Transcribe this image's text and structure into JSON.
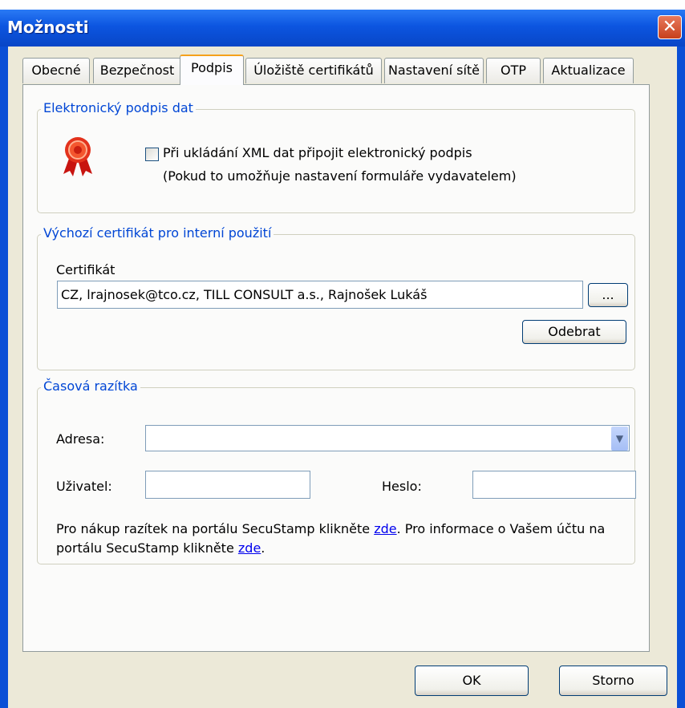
{
  "window": {
    "title": "Možnosti"
  },
  "tabs": [
    {
      "label": "Obecné"
    },
    {
      "label": "Bezpečnost"
    },
    {
      "label": "Podpis"
    },
    {
      "label": "Úložiště certifikátů"
    },
    {
      "label": "Nastavení sítě"
    },
    {
      "label": "OTP"
    },
    {
      "label": "Aktualizace"
    }
  ],
  "active_tab": "Podpis",
  "signature_group": {
    "legend": "Elektronický podpis dat",
    "icon": "award-ribbon-icon",
    "checkbox_label": "Při ukládání XML dat připojit elektronický podpis",
    "checkbox_checked": false,
    "note": "(Pokud to umožňuje nastavení formuláře vydavatelem)"
  },
  "certificate_group": {
    "legend": "Výchozí certifikát pro interní použití",
    "label": "Certifikát",
    "value": "CZ, lrajnosek@tco.cz, TILL CONSULT a.s., Rajnošek Lukáš",
    "browse_label": "...",
    "remove_label": "Odebrat"
  },
  "timestamp_group": {
    "legend": "Časová razítka",
    "address_label": "Adresa:",
    "address_value": "",
    "user_label": "Uživatel:",
    "user_value": "",
    "password_label": "Heslo:",
    "password_value": "",
    "info_text_1": "Pro nákup razítek na portálu SecuStamp klikněte ",
    "link_1": "zde",
    "info_text_2": ".  Pro informace o Vašem účtu na",
    "info_text_3": "portálu SecuStamp klikněte ",
    "link_2": "zde",
    "info_text_4": "."
  },
  "buttons": {
    "ok": "OK",
    "cancel": "Storno"
  },
  "colors": {
    "titlebar": "#0c55e0",
    "legend_text": "#0046d5",
    "active_tab_accent": "#f5a11c",
    "dialog_bg": "#ece9d8"
  }
}
